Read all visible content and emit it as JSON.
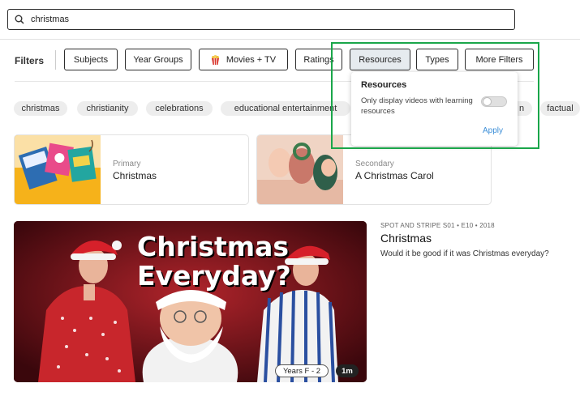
{
  "search": {
    "value": "christmas",
    "placeholder": ""
  },
  "filters": {
    "label": "Filters",
    "buttons": [
      "Subjects",
      "Year Groups",
      "Movies + TV",
      "Ratings",
      "Resources",
      "Types",
      "More Filters"
    ]
  },
  "tags": [
    "christmas",
    "christianity",
    "celebrations",
    "educational entertainment",
    "n",
    "factual"
  ],
  "cards": [
    {
      "kind": "Primary",
      "title": "Christmas"
    },
    {
      "kind": "Secondary",
      "title": "A Christmas Carol"
    }
  ],
  "video": {
    "meta": "SPOT AND STRIPE S01 • E10 • 2018",
    "title": "Christmas",
    "description": "Would it be good if it was Christmas everyday?",
    "overlay_line1": "Christmas",
    "overlay_line2": "Everyday?",
    "year_badge": "Years F - 2",
    "duration": "1m"
  },
  "popup": {
    "title": "Resources",
    "text": "Only display videos with learning resources",
    "toggle_on": false,
    "apply": "Apply"
  },
  "colors": {
    "accent": "#3d8fd8",
    "highlight": "#1aa64a"
  }
}
